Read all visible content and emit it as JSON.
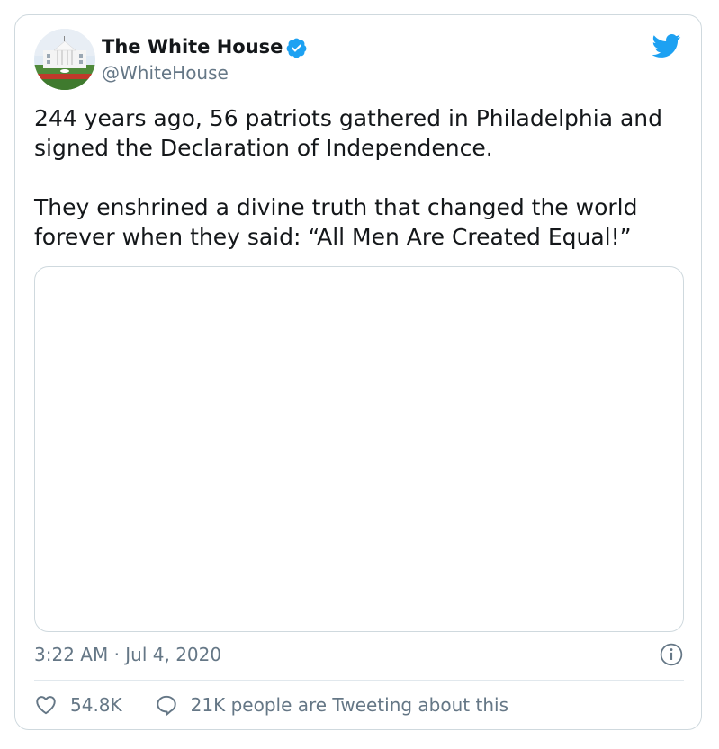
{
  "author": {
    "display_name": "The White House",
    "handle": "@WhiteHouse",
    "verified": true
  },
  "tweet": {
    "paragraphs": [
      "244 years ago, 56 patriots gathered in Philadelphia and signed the Declaration of Independence.",
      "They enshrined a divine truth that changed the world forever when they said: “All Men Are Created Equal!”"
    ],
    "timestamp": "3:22 AM · Jul 4, 2020"
  },
  "engagement": {
    "likes": "54.8K",
    "conversation": "21K people are Tweeting about this"
  },
  "icons": {
    "verified": "verified-badge-icon",
    "brand": "twitter-bird-icon",
    "info": "info-icon",
    "like": "heart-icon",
    "reply": "speech-bubble-icon"
  },
  "colors": {
    "brand_blue": "#1da1f2",
    "text_primary": "#14171a",
    "text_secondary": "#657786",
    "border": "#cfd9de"
  }
}
